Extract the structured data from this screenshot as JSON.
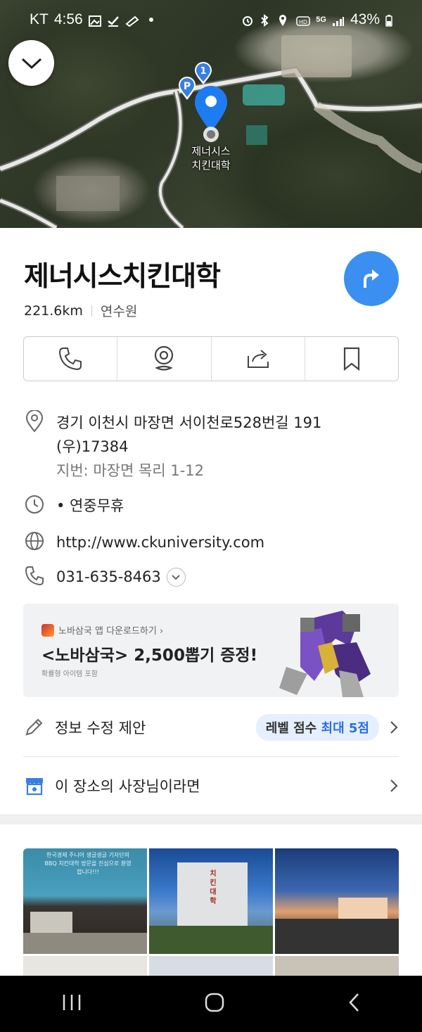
{
  "status_bar": {
    "carrier": "KT",
    "time": "4:56",
    "battery": "43%",
    "network": "5G"
  },
  "map": {
    "place_label_line1": "제너시스",
    "place_label_line2": "치킨대학",
    "parking_marker": "P",
    "number_marker": "1"
  },
  "place": {
    "name": "제너시스치킨대학",
    "distance": "221.6km",
    "station": "연수원"
  },
  "details": {
    "address": "경기 이천시 마장면 서이천로528번길 191",
    "postal": "(우)17384",
    "lot_address": "지번: 마장면 목리 1-12",
    "hours": "• 연중무휴",
    "website": "http://www.ckuniversity.com",
    "phone": "031-635-8463"
  },
  "ad": {
    "app_line": "노바삼국 앱 다운로드하기 ›",
    "headline": "<노바삼국> 2,500뽑기 증정!",
    "fine_print": "확률형 아이템 포함"
  },
  "suggest": {
    "label": "정보 수정 제안",
    "pill_prefix": "레벨 점수 ",
    "pill_highlight": "최대 5점"
  },
  "owner": {
    "label": "이 장소의 사장님이라면"
  },
  "photos": [
    {
      "caption": "한국경제 주니어 생글생글 기자단의 BBQ 치킨대학 방문을 진심으로 환영합니다!!!"
    },
    {
      "caption": "치킨대학"
    }
  ],
  "icons": [
    "collapse-chevron-icon",
    "route-arrow-icon",
    "phone-icon",
    "streetview-icon",
    "share-icon",
    "bookmark-icon",
    "location-pin-icon",
    "clock-icon",
    "globe-icon",
    "pencil-icon",
    "store-icon",
    "chevron-right-icon"
  ],
  "colors": {
    "accent": "#3a8ff0",
    "link": "#2a7fe0",
    "pill_bg": "#e5efff"
  }
}
